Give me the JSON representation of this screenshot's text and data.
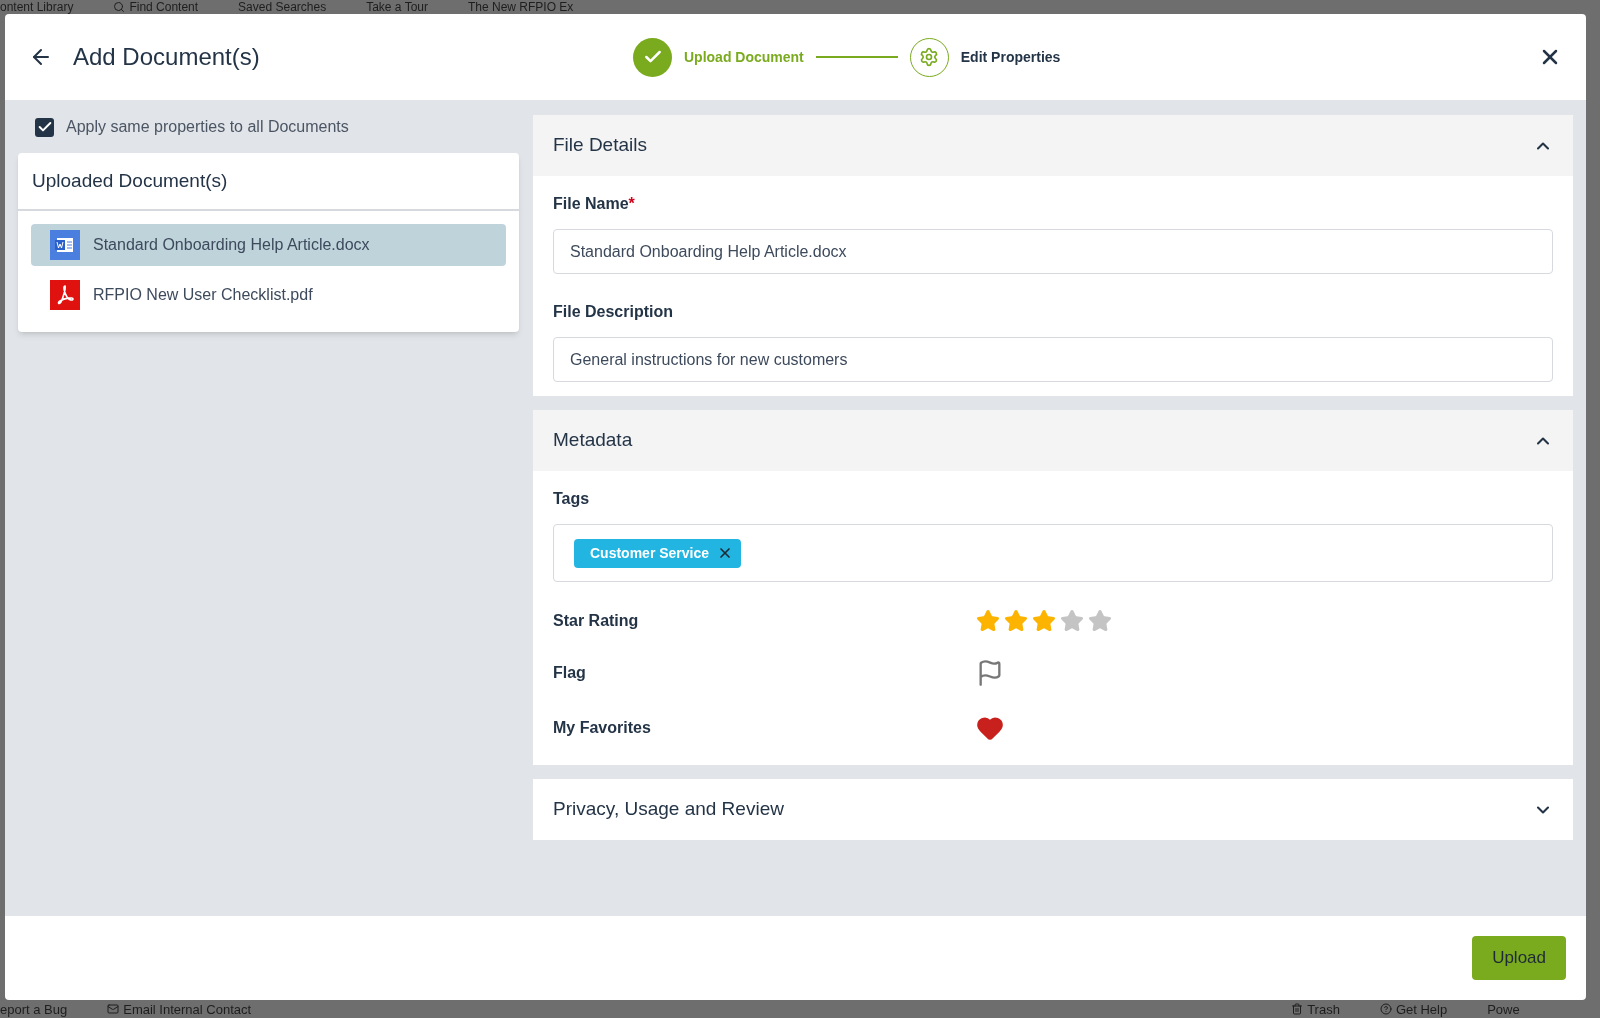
{
  "background": {
    "top_bar": [
      "ontent Library",
      "Find Content",
      "Saved Searches",
      "Take a Tour",
      "The New RFPIO Ex"
    ],
    "bottom_bar": [
      "eport a Bug",
      "Email Internal Contact",
      "Trash",
      "Get Help",
      "Powe"
    ]
  },
  "dialog": {
    "title": "Add Document(s)",
    "steps": [
      {
        "label": "Upload Document",
        "done": true
      },
      {
        "label": "Edit Properties",
        "done": false
      }
    ]
  },
  "apply_all": {
    "label": "Apply same properties to all Documents",
    "checked": true
  },
  "uploaded": {
    "title": "Uploaded Document(s)",
    "items": [
      {
        "name": "Standard Onboarding Help Article.docx",
        "kind": "word",
        "selected": true
      },
      {
        "name": "RFPIO New User Checklist.pdf",
        "kind": "pdf",
        "selected": false
      }
    ]
  },
  "file_details": {
    "title": "File Details",
    "expanded": true,
    "file_name_label": "File Name",
    "required_mark": "*",
    "file_name": "Standard Onboarding Help Article.docx",
    "description_label": "File Description",
    "description": "General instructions for new customers"
  },
  "metadata": {
    "title": "Metadata",
    "expanded": true,
    "tags_label": "Tags",
    "tags": [
      "Customer Service"
    ],
    "star_label": "Star Rating",
    "stars": 3,
    "flag_label": "Flag",
    "flagged": false,
    "favorites_label": "My Favorites",
    "favorite": true
  },
  "privacy": {
    "title": "Privacy, Usage and Review",
    "expanded": false
  },
  "upload_button": "Upload"
}
